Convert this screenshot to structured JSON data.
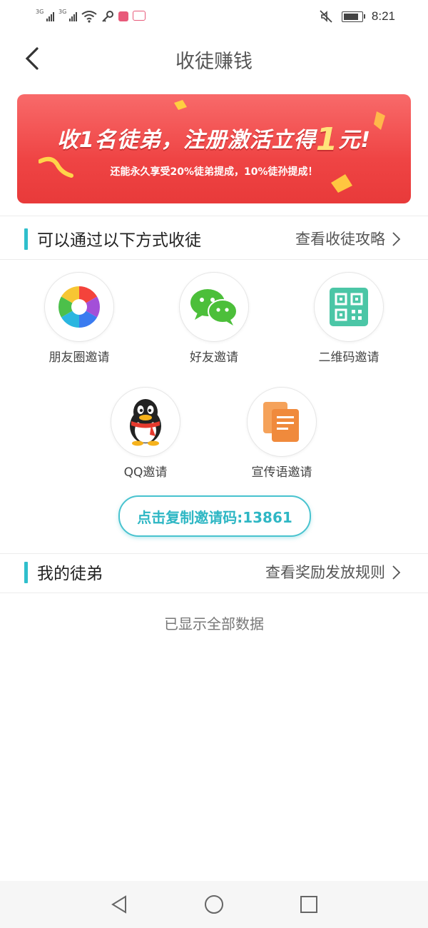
{
  "status_bar": {
    "signal1_tag": "3G",
    "signal2_tag": "3G",
    "time": "8:21"
  },
  "header": {
    "title": "收徒赚钱"
  },
  "banner": {
    "headline_part1": "收1名徒弟，注册激活立得",
    "headline_amount": "1",
    "headline_part2": "元!",
    "subline": "还能永久享受20%徒弟提成，10%徒孙提成！"
  },
  "invite_section": {
    "title": "可以通过以下方式收徒",
    "link": "查看收徒攻略",
    "options": [
      {
        "label": "朋友圈邀请"
      },
      {
        "label": "好友邀请"
      },
      {
        "label": "二维码邀请"
      },
      {
        "label": "QQ邀请"
      },
      {
        "label": "宣传语邀请"
      }
    ],
    "copy_button": "点击复制邀请码:13861"
  },
  "disciples_section": {
    "title": "我的徒弟",
    "link": "查看奖励发放规则",
    "empty_text": "已显示全部数据"
  },
  "colors": {
    "accent": "#2fbfcc",
    "banner_red": "#ef4444"
  }
}
